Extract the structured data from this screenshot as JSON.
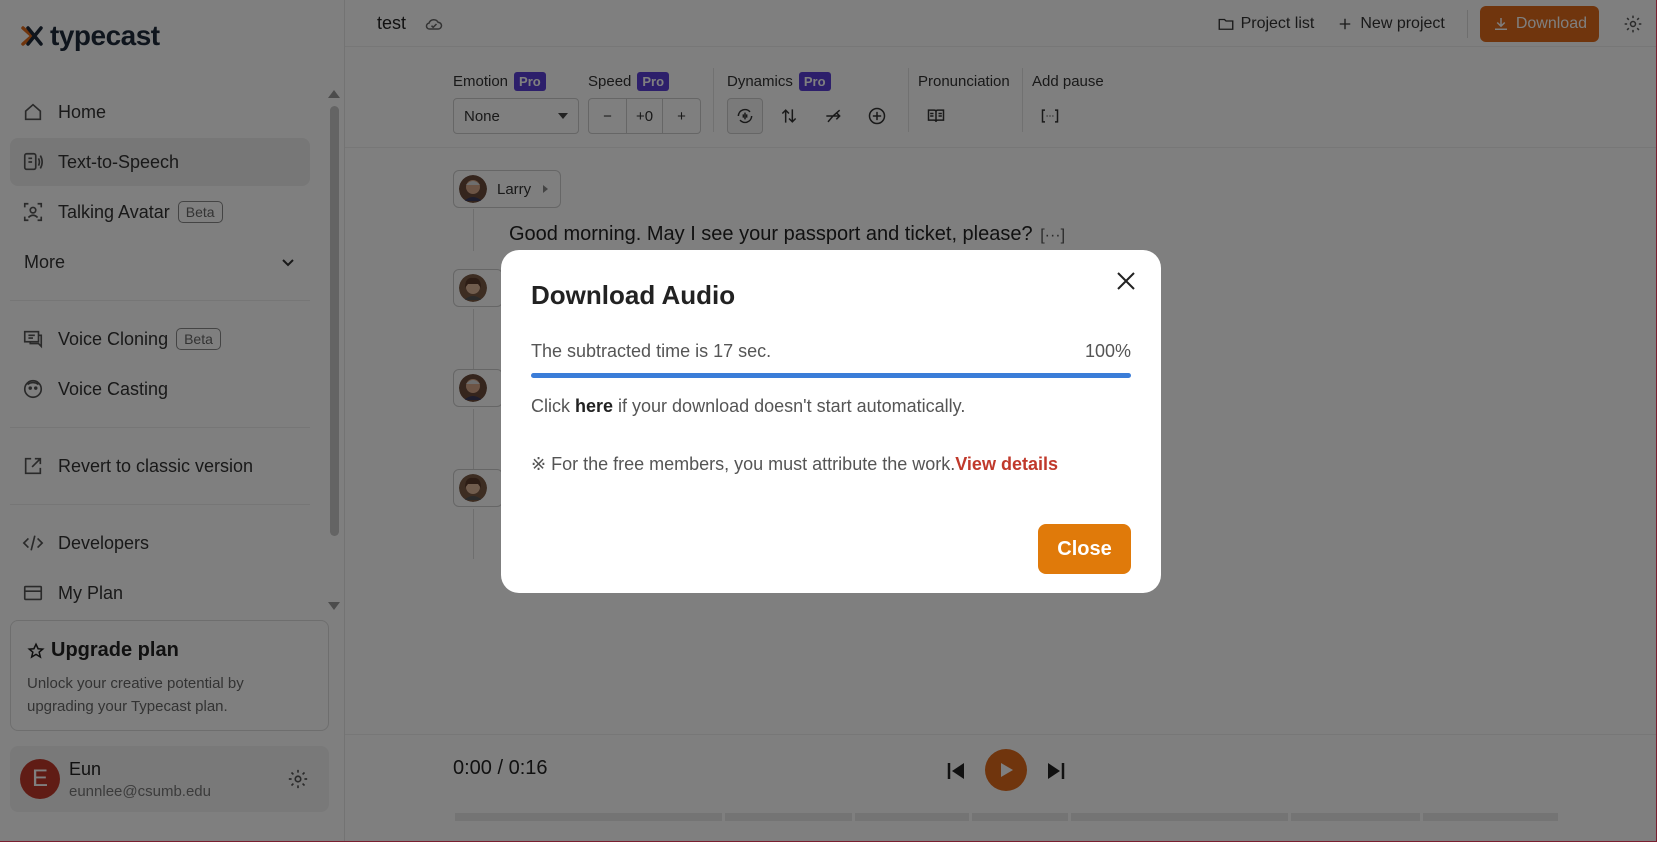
{
  "brand": {
    "name": "typecast",
    "accent": "#e06a1b"
  },
  "sidebar": {
    "items": [
      {
        "label": "Home",
        "icon": "home-icon"
      },
      {
        "label": "Text-to-Speech",
        "icon": "tts-icon",
        "active": true
      },
      {
        "label": "Talking Avatar",
        "icon": "avatar-icon",
        "badge": "Beta"
      }
    ],
    "more_label": "More",
    "items2": [
      {
        "label": "Voice Cloning",
        "icon": "chat-icon",
        "badge": "Beta"
      },
      {
        "label": "Voice Casting",
        "icon": "face-icon"
      }
    ],
    "revert_label": "Revert to classic version",
    "developers_label": "Developers",
    "plan_label": "My Plan",
    "upgrade": {
      "title": "Upgrade plan",
      "desc": "Unlock your creative potential by upgrading your Typecast plan."
    },
    "user": {
      "initial": "E",
      "name": "Eun",
      "email": "eunnlee@csumb.edu"
    }
  },
  "topbar": {
    "project_title": "test",
    "project_list": "Project list",
    "new_project": "New project",
    "download": "Download"
  },
  "toolbar": {
    "emotion_label": "Emotion",
    "emotion_value": "None",
    "speed_label": "Speed",
    "speed_value": "+0",
    "dynamics_label": "Dynamics",
    "pro_badge": "Pro",
    "pronunciation_label": "Pronunciation",
    "pause_label": "Add pause"
  },
  "editor": {
    "speaker1": "Larry",
    "line1": "Good morning. May I see your passport and ticket, please?",
    "pause_mark": "[···]"
  },
  "player": {
    "time": "0:00 / 0:16",
    "help": "?"
  },
  "modal": {
    "title": "Download Audio",
    "progress_text": "The subtracted time is 17 sec.",
    "progress_percent": "100%",
    "progress_value": 1.0,
    "hint_prefix": "Click ",
    "hint_link": "here",
    "hint_suffix": " if your download doesn't start automatically.",
    "notice_text": "※ For the free members, you must attribute the work.",
    "notice_link": "View details",
    "close_label": "Close"
  }
}
